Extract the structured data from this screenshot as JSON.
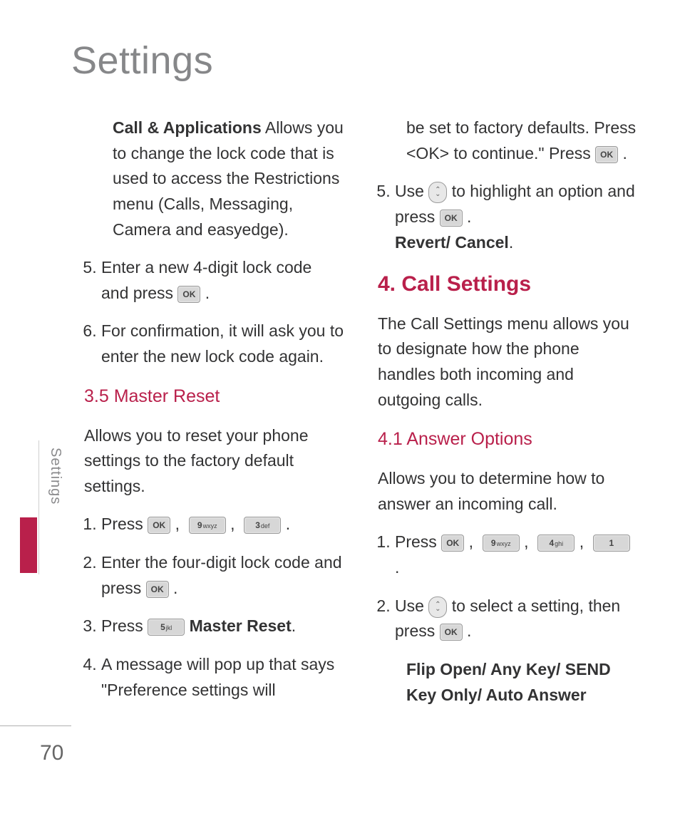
{
  "page_title": "Settings",
  "side_tab": {
    "label": "Settings"
  },
  "page_number": "70",
  "keys": {
    "ok": "OK",
    "k1": "1",
    "k3": "3",
    "k3_sub": "def",
    "k4": "4",
    "k4_sub": "ghi",
    "k5": "5",
    "k5_sub": "jkl",
    "k9": "9",
    "k9_sub": "wxyz"
  },
  "left": {
    "intro_strong": "Call & Applications",
    "intro_rest": " Allows you to change the lock code that is used to access the Restrictions menu (Calls, Messaging, Camera and easyedge).",
    "step5": "Enter a new 4-digit lock code and press ",
    "step6": "For confirmation, it will ask you to enter the new lock code again.",
    "h35": "3.5 Master Reset",
    "h35_body": "Allows you to reset your phone settings to the factory default settings.",
    "mr1_a": "Press ",
    "mr2_a": "Enter the four-digit lock code and press ",
    "mr3_a": "Press ",
    "mr3_b": "Master Reset",
    "mr4_a": "A message will pop up that says \"Preference settings will"
  },
  "right": {
    "cont_a": "be set to factory defaults. Press <OK> to continue.\" Press ",
    "step5_a": "Use ",
    "step5_b": " to highlight an option and press ",
    "step5_c": "Revert/ Cancel",
    "h4": "4. Call Settings",
    "h4_body": "The Call Settings menu allows you to designate how the phone handles both incoming and outgoing calls.",
    "h41": "4.1 Answer Options",
    "h41_body": "Allows you to determine how to answer an incoming call.",
    "ao1_a": "Press ",
    "ao2_a": "Use ",
    "ao2_b": " to select a setting, then press ",
    "ao_opt": "Flip Open/ Any Key/ SEND Key Only/ Auto Answer"
  }
}
